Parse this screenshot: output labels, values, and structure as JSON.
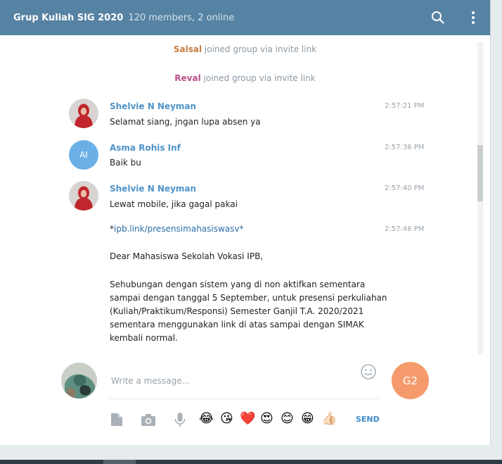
{
  "header": {
    "title": "Grup Kuliah SIG 2020",
    "subtitle": "120 members, 2 online"
  },
  "service": [
    {
      "name": "Salsal",
      "text": "joined group via invite link",
      "color": "#c77b3e"
    },
    {
      "name": "Reval",
      "text": "joined group via invite link",
      "color": "#b8508c"
    }
  ],
  "messages": [
    {
      "author": "Shelvie N Neyman",
      "time": "2:57:21 PM",
      "text": "Selamat siang, jngan lupa absen ya"
    },
    {
      "author": "Asma Rohis Inf",
      "initials": "AI",
      "time": "2:57:36 PM",
      "text": "Baik bu"
    },
    {
      "author": "Shelvie N Neyman",
      "time": "2:57:40 PM",
      "text": "Lewat mobile, jika gagal pakai"
    },
    {
      "time": "2:57:46 PM",
      "prefix": "*",
      "link": "ipb.link/presensimahasiswasv*",
      "lines": [
        "Dear Mahasiswa Sekolah Vokasi IPB,",
        "Sehubungan dengan sistem yang di non aktifkan sementara",
        "sampai dengan tanggal 5 September, untuk presensi perkuliahan",
        "(Kuliah/Praktikum/Responsi) Semester Ganjil T.A. 2020/2021",
        "sementara menggunakan link di atas sampai dengan SIMAK",
        "kembali normal."
      ]
    }
  ],
  "composer": {
    "placeholder": "Write a message...",
    "my_initials": "G2",
    "send_label": "SEND",
    "emojis": [
      "😂",
      "😘",
      "❤️",
      "😍",
      "😊",
      "😁",
      "👍🏻"
    ]
  },
  "colors": {
    "header": "#5682a3",
    "accent": "#4f93c7",
    "my_avatar": "#f59b6b"
  }
}
